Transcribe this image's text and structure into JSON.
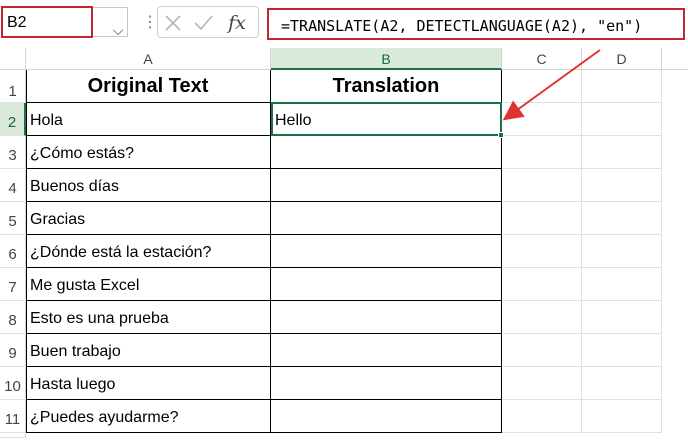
{
  "formula_bar": {
    "name_box": "B2",
    "name_box_dropdown_icon": "chevron-down-icon",
    "separator": "⋮",
    "cancel_icon": "close-icon",
    "enter_icon": "check-icon",
    "function_icon": "fx-icon",
    "function_label": "fx",
    "formula": "=TRANSLATE(A2, DETECTLANGUAGE(A2), \"en\")"
  },
  "columns": [
    "A",
    "B",
    "C",
    "D"
  ],
  "rows": [
    "1",
    "2",
    "3",
    "4",
    "5",
    "6",
    "7",
    "8",
    "9",
    "10",
    "11"
  ],
  "table": {
    "headers": [
      "Original Text",
      "Translation"
    ],
    "original": [
      "Hola",
      "¿Cómo estás?",
      "Buenos días",
      "Gracias",
      "¿Dónde está la estación?",
      "Me gusta Excel",
      "Esto es una prueba",
      "Buen trabajo",
      "Hasta luego",
      "¿Puedes ayudarme?"
    ],
    "translation": [
      "Hello",
      "",
      "",
      "",
      "",
      "",
      "",
      "",
      "",
      ""
    ]
  },
  "colors": {
    "highlight_red": "#c0282d",
    "excel_green": "#1e7145"
  }
}
